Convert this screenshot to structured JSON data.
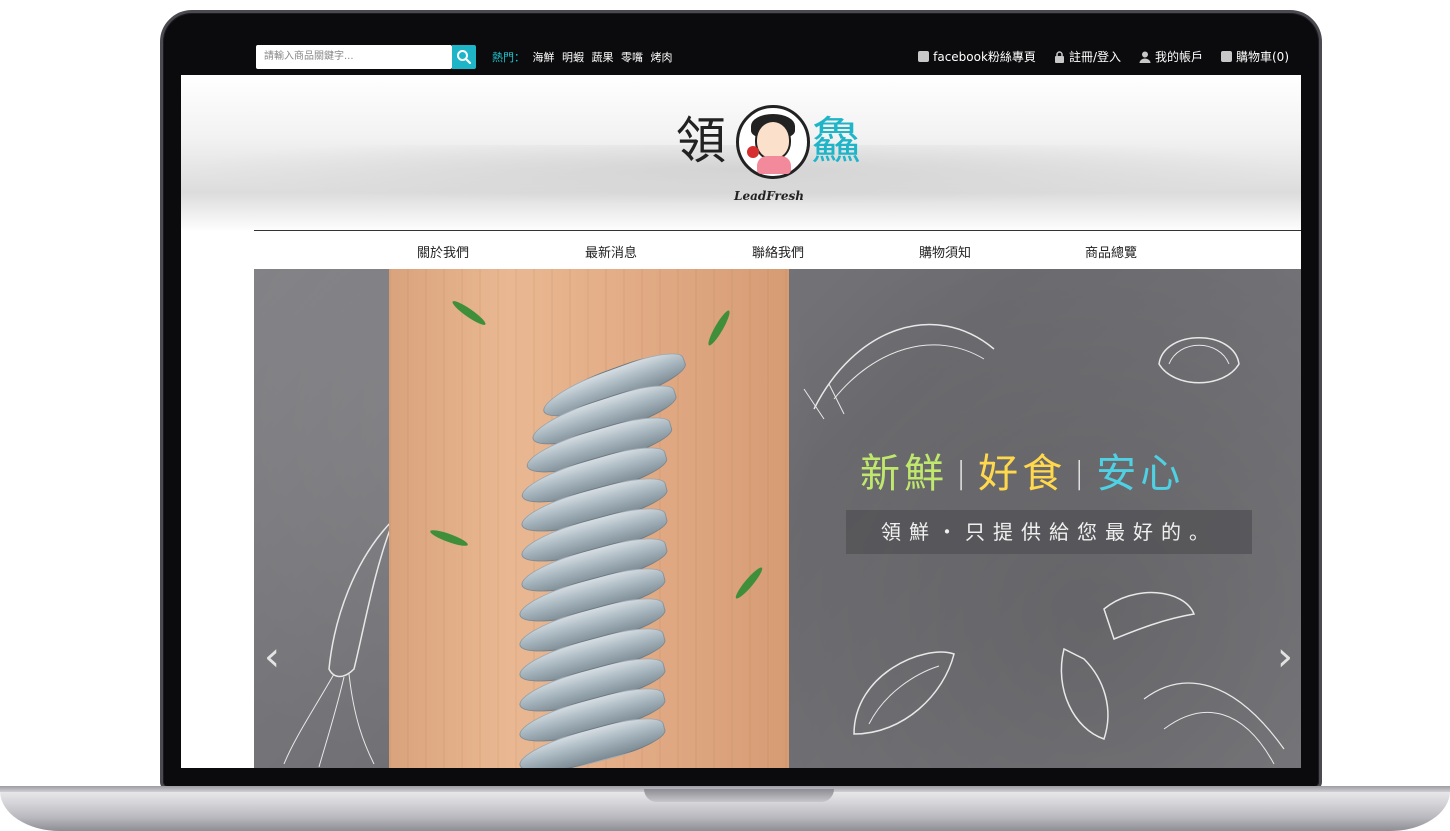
{
  "topbar": {
    "search_placeholder": "請輸入商品關鍵字...",
    "hot_label": "熱門：",
    "hot_links": [
      "海鮮",
      "明蝦",
      "蔬果",
      "零嘴",
      "烤肉"
    ],
    "links": [
      "facebook粉絲專頁",
      "註冊/登入",
      "我的帳戶",
      "購物車(0)"
    ]
  },
  "header": {
    "logo_left": "領",
    "logo_right": "鱻",
    "logo_sub": "LeadFresh"
  },
  "nav": [
    "關於我們",
    "最新消息",
    "聯絡我們",
    "購物須知",
    "商品總覽"
  ],
  "hero": {
    "tag1": "新鮮",
    "tag2": "好食",
    "tag3": "安心",
    "separator": "|",
    "subtitle": "領鮮・只提供給您最好的。",
    "prev": "‹",
    "next": "›"
  },
  "colors": {
    "accent_teal": "#1fb5c8",
    "tag_green": "#bfe86c",
    "tag_yellow": "#ffd84c",
    "tag_blue": "#4fd0e3"
  }
}
